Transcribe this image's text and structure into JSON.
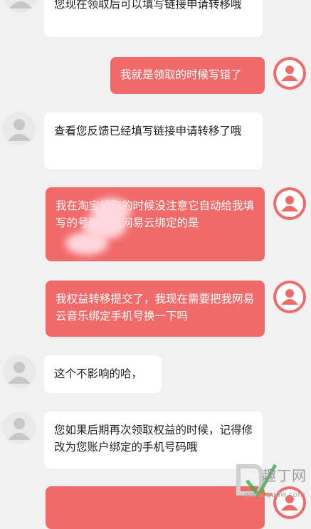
{
  "messages": [
    {
      "from": "agent",
      "text": "您现在领取后可以填写链接申请转移哦"
    },
    {
      "from": "user",
      "text": "我就是领取的时候写错了"
    },
    {
      "from": "agent",
      "text": "查看您反馈已经填写链接申请转移了哦"
    },
    {
      "from": "user",
      "text": "我在淘宝领取的时候没注意它自动给我填写的号码，我网易云绑定的是"
    },
    {
      "from": "user",
      "text": "我权益转移提交了，我现在需要把我网易云音乐绑定手机号换一下吗"
    },
    {
      "from": "agent",
      "text": "这个不影响的哈，"
    },
    {
      "from": "agent",
      "text": "您如果后期再次领取权益的时候，记得修改为您账户绑定的手机号码哦"
    },
    {
      "from": "user",
      "text": ""
    }
  ],
  "watermark": {
    "text": "趣丁网",
    "url": "www.qudw.com"
  },
  "colors": {
    "user_bubble": "#f16a6a",
    "agent_bubble": "#ffffff",
    "background": "#f1f1f1"
  }
}
